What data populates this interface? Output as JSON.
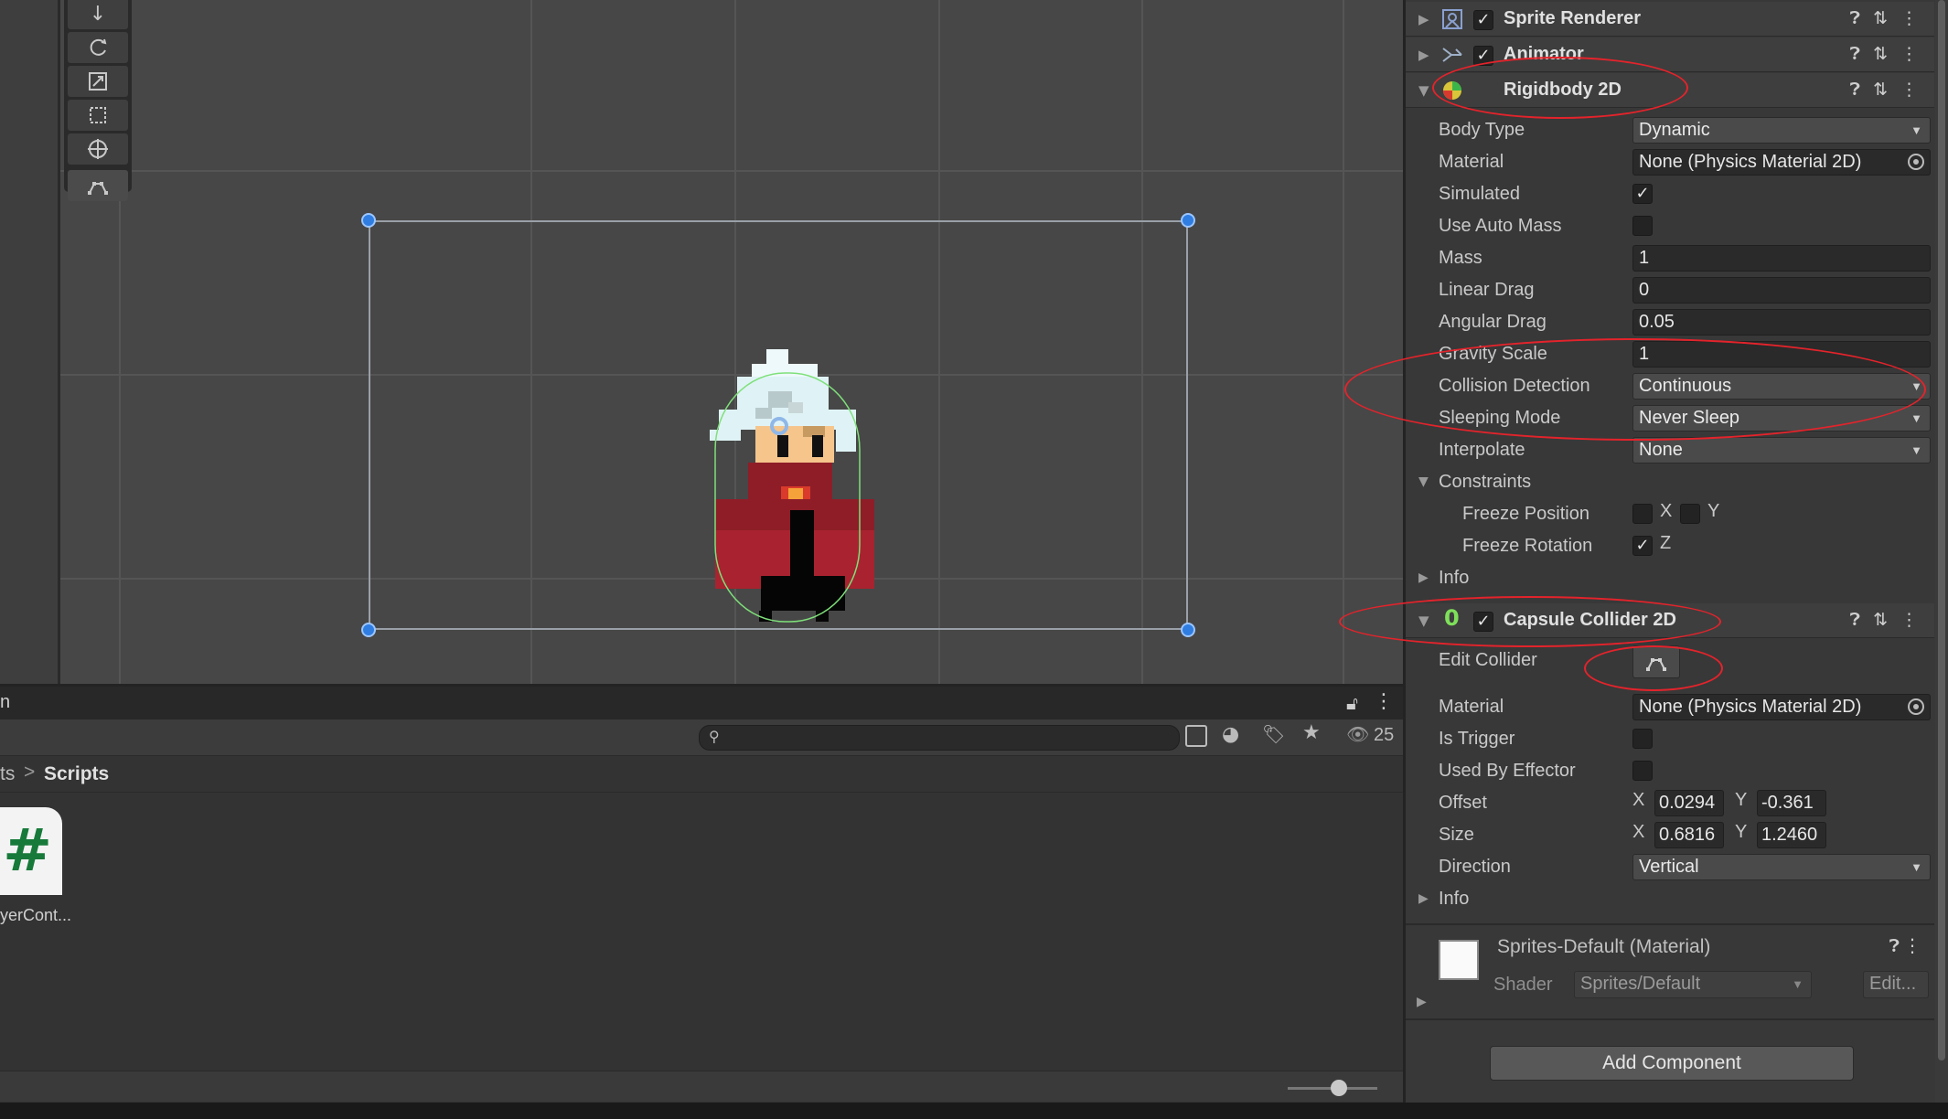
{
  "inspector": {
    "components": {
      "sprite_renderer": {
        "title": "Sprite Renderer",
        "enabled": true
      },
      "animator": {
        "title": "Animator",
        "enabled": true
      },
      "rigidbody": {
        "title": "Rigidbody 2D",
        "body_type_label": "Body Type",
        "body_type": "Dynamic",
        "material_label": "Material",
        "material": "None (Physics Material 2D)",
        "simulated_label": "Simulated",
        "simulated": true,
        "use_auto_mass_label": "Use Auto Mass",
        "use_auto_mass": false,
        "mass_label": "Mass",
        "mass": "1",
        "linear_drag_label": "Linear Drag",
        "linear_drag": "0",
        "angular_drag_label": "Angular Drag",
        "angular_drag": "0.05",
        "gravity_scale_label": "Gravity Scale",
        "gravity_scale": "1",
        "collision_detection_label": "Collision Detection",
        "collision_detection": "Continuous",
        "sleeping_mode_label": "Sleeping Mode",
        "sleeping_mode": "Never Sleep",
        "interpolate_label": "Interpolate",
        "interpolate": "None",
        "constraints_label": "Constraints",
        "freeze_position_label": "Freeze Position",
        "freeze_position_x_label": "X",
        "freeze_position_y_label": "Y",
        "freeze_rotation_label": "Freeze Rotation",
        "freeze_rotation_z_label": "Z",
        "info_label": "Info"
      },
      "capsule_collider": {
        "title": "Capsule Collider 2D",
        "enabled": true,
        "edit_collider_label": "Edit Collider",
        "material_label": "Material",
        "material": "None (Physics Material 2D)",
        "is_trigger_label": "Is Trigger",
        "used_by_effector_label": "Used By Effector",
        "offset_label": "Offset",
        "offset_x": "0.0294",
        "offset_y": "-0.361",
        "size_label": "Size",
        "size_x": "0.6816",
        "size_y": "1.2460",
        "x_label": "X",
        "y_label": "Y",
        "direction_label": "Direction",
        "direction": "Vertical",
        "info_label": "Info"
      }
    },
    "material": {
      "title": "Sprites-Default (Material)",
      "shader_label": "Shader",
      "shader": "Sprites/Default",
      "edit_label": "Edit..."
    },
    "add_component_label": "Add Component"
  },
  "project": {
    "tab_label_fragment": "n",
    "visible_count": "25",
    "breadcrumb": {
      "parent_fragment": "ts",
      "separator": ">",
      "current": "Scripts"
    },
    "asset": {
      "label": "yerCont...",
      "glyph": "#"
    }
  },
  "colors": {
    "annotation_red": "#e4232b",
    "selection_handle": "#2f7de1",
    "csharp_icon_green": "#177a3a"
  },
  "icons": [
    "move-tool-icon",
    "rotate-tool-icon",
    "scale-tool-icon",
    "rect-tool-icon",
    "transform-tool-icon",
    "edit-collider-icon",
    "help-icon",
    "presets-icon",
    "kebab-menu-icon",
    "lock-icon",
    "search-icon",
    "tag-icon",
    "star-icon",
    "eye-icon",
    "object-picker-icon"
  ]
}
